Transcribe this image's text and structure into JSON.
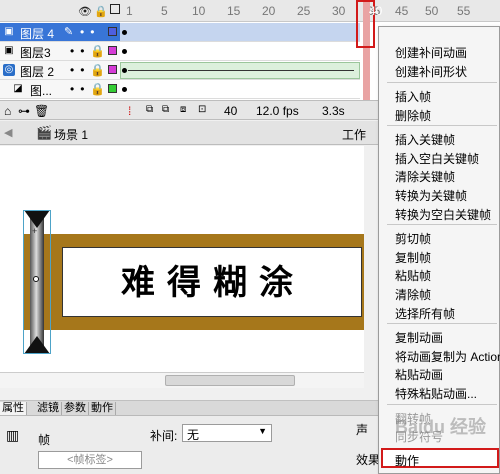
{
  "timeline": {
    "ruler_ticks": [
      "1",
      "5",
      "10",
      "15",
      "20",
      "25",
      "30",
      "35",
      "40",
      "45",
      "50",
      "55"
    ],
    "layers": [
      {
        "name": "图层 4",
        "selected": true,
        "swatch": "#4e5fe0",
        "has_tween": false
      },
      {
        "name": "图层3",
        "selected": false,
        "swatch": "#d53bd6",
        "has_tween": false
      },
      {
        "name": "图层 2",
        "selected": false,
        "swatch": "#d53bd6",
        "has_tween": true
      },
      {
        "name": "图...",
        "selected": false,
        "swatch": "#33cc33",
        "has_tween": false
      }
    ],
    "footer": {
      "frame": "40",
      "fps": "12.0 fps",
      "time": "3.3s"
    }
  },
  "scene": {
    "label": "场景 1",
    "workspace_label": "工作"
  },
  "stage": {
    "calligraphy": "难得糊涂"
  },
  "properties": {
    "tabs": [
      "属性",
      "滤镜",
      "参数",
      "動作"
    ],
    "frame_label": "帧",
    "frame_name_placeholder": "<帧标签>",
    "tween_label": "补间:",
    "tween_value": "无",
    "sound_label": "声",
    "effect_label": "效果"
  },
  "context_menu": {
    "items": [
      "创建补间动画",
      "创建补间形状",
      "插入帧",
      "删除帧",
      "插入关键帧",
      "插入空白关键帧",
      "清除关键帧",
      "转换为关键帧",
      "转换为空白关键帧",
      "剪切帧",
      "复制帧",
      "粘贴帧",
      "清除帧",
      "选择所有帧",
      "复制动画",
      "将动画复制为 Action",
      "粘贴动画",
      "特殊粘贴动画...",
      "翻转帧",
      "同步符号",
      "動作"
    ],
    "highlighted": "動作"
  },
  "watermark": "Baidu 经验",
  "colors": {
    "selection": "#3875d7",
    "highlight_border": "#d21a1a",
    "frame_bar": "#a6771b"
  }
}
